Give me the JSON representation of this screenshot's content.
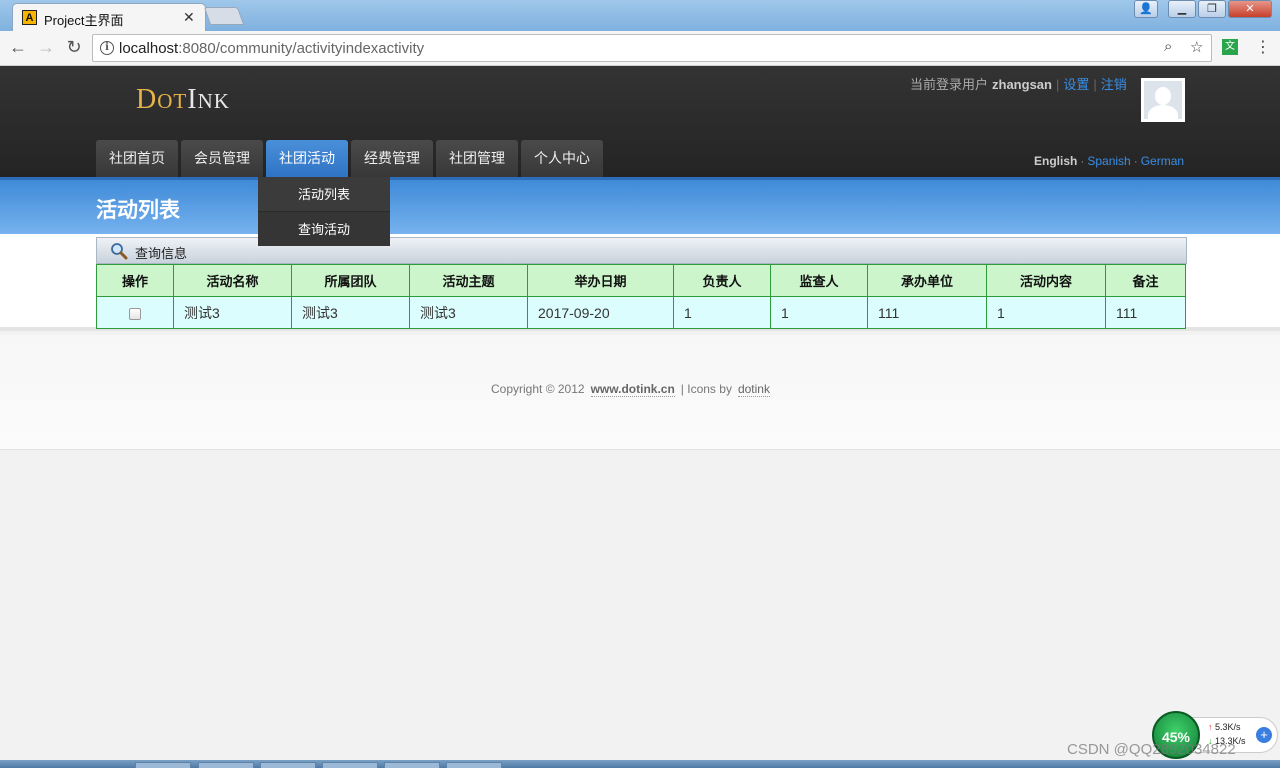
{
  "browser": {
    "tab_title": "Project主界面",
    "favicon_letter": "A",
    "url_host": "localhost",
    "url_path": ":8080/community/activityindexactivity",
    "ext_label": "文"
  },
  "header": {
    "logo_d": "D",
    "logo_ot": "OT",
    "logo_i": "I",
    "logo_nk": "NK",
    "login_prefix": "当前登录用户",
    "username": "zhangsan",
    "settings_link": "设置",
    "logout_link": "注销"
  },
  "nav": {
    "items": [
      "社团首页",
      "会员管理",
      "社团活动",
      "经费管理",
      "社团管理",
      "个人中心"
    ],
    "active_index": 2
  },
  "languages": {
    "current": "English",
    "spanish": "Spanish",
    "german": "German"
  },
  "page_title": "活动列表",
  "dropdown": {
    "items": [
      "活动列表",
      "查询活动"
    ]
  },
  "query_bar": {
    "label": "查询信息"
  },
  "table": {
    "headers": [
      "操作",
      "活动名称",
      "所属团队",
      "活动主题",
      "举办日期",
      "负责人",
      "监查人",
      "承办单位",
      "活动内容",
      "备注"
    ],
    "rows": [
      {
        "checked": false,
        "name": "测试3",
        "team": "测试3",
        "theme": "测试3",
        "date": "2017-09-20",
        "leader": "1",
        "supervisor": "1",
        "organizer": "111",
        "content": "1",
        "remark": "111"
      }
    ]
  },
  "footer": {
    "copyright": "Copyright © 2012",
    "site": "www.dotink.cn",
    "icons_by": "| Icons by",
    "author": "dotink"
  },
  "speed_widget": {
    "percent": "45%",
    "up": "5.3K/s",
    "down": "13.3K/s"
  },
  "watermark": "CSDN @QQ2892034822",
  "colors": {
    "accent_blue": "#3a8ee6",
    "active_tab": "#2f74c4",
    "table_header": "#ccf5cc",
    "table_cell": "#dcfdfd",
    "table_border": "#2f9a3a"
  }
}
